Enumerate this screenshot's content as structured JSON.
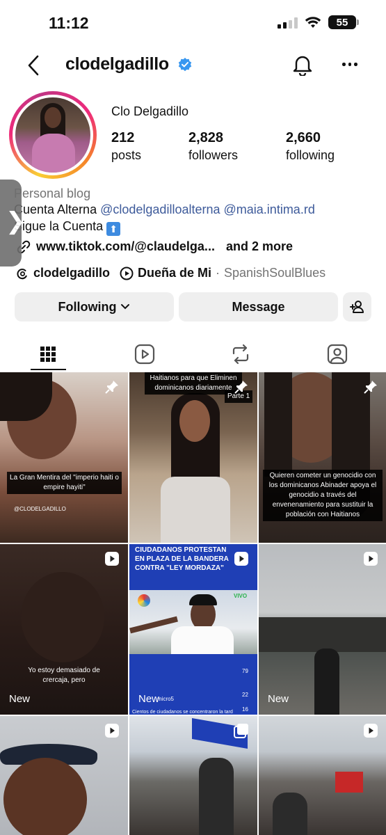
{
  "status": {
    "time": "11:12",
    "battery": "55"
  },
  "header": {
    "username": "clodelgadillo"
  },
  "profile": {
    "display_name": "Clo Delgadillo",
    "stats": [
      {
        "value": "212",
        "label": "posts"
      },
      {
        "value": "2,828",
        "label": "followers"
      },
      {
        "value": "2,660",
        "label": "following"
      }
    ],
    "category": "Personal blog",
    "bio_line1_prefix": "Cuenta Alterna",
    "bio_mention1": "@clodelgadilloalterna",
    "bio_mention2": "@maia.intima.rd",
    "bio_line2": "Sigue la Cuenta",
    "link": "www.tiktok.com/@claudelga...",
    "link_more": "and 2 more",
    "threads_handle": "clodelgadillo",
    "song": "Dueña de Mi",
    "song_artist": "SpanishSoulBlues"
  },
  "buttons": {
    "following": "Following",
    "message": "Message"
  },
  "tabs": [
    "grid-icon",
    "reels-icon",
    "repost-icon",
    "tagged-icon"
  ],
  "posts": [
    {
      "type": "pinned",
      "caption": "La Gran Mentira del \"imperio haiti o empire hayiti\"",
      "watermark": "@CLODELGADILLO"
    },
    {
      "type": "pinned",
      "top_text": "Haitianos para que Eliminen dominicanos diariamente",
      "tag": "Parte 1"
    },
    {
      "type": "pinned",
      "caption": "Quieren cometer un genocidio con los dominicanos Abinader apoya el genocidio a través del envenenamiento para sustituir la población con Haitianos"
    },
    {
      "type": "reel",
      "caption": "Yo estoy demasiado de crercaja, pero",
      "badge": "New"
    },
    {
      "type": "reel",
      "headline": "CIUDADANOS PROTESTAN EN PLAZA DE LA BANDERA CONTRA \"LEY MORDAZA\"",
      "brand": "VIVO",
      "counts": [
        "79",
        "22",
        "16"
      ],
      "handle": "micro5",
      "footer": "Cientos de ciudadanos se concentraron la tard",
      "badge": "New"
    },
    {
      "type": "reel",
      "badge": "New"
    },
    {
      "type": "reel"
    },
    {
      "type": "carousel"
    },
    {
      "type": "reel"
    }
  ]
}
